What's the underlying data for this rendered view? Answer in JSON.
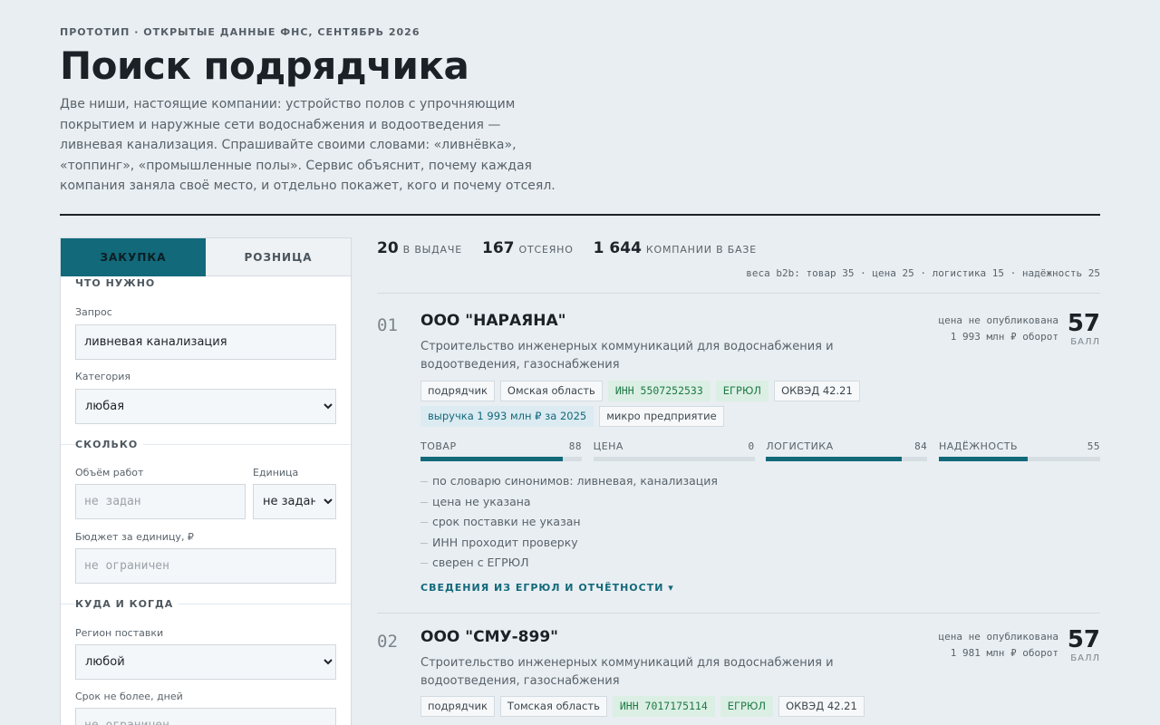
{
  "header": {
    "eyebrow": "ПРОТОТИП · ОТКРЫТЫЕ ДАННЫЕ ФНС, СЕНТЯБРЬ 2026",
    "title": "Поиск подрядчика",
    "lead": "Две ниши, настоящие компании: устройство полов с упрочняющим покрытием и наружные сети водоснабжения и водоотведения — ливневая канализация. Спрашивайте своими словами: «ливнёвка», «топпинг», «промышленные полы». Сервис объяснит, почему каждая компания заняла своё место, и отдельно покажет, кого и почему отсеял."
  },
  "tabs": [
    {
      "label": "ЗАКУПКА",
      "active": true
    },
    {
      "label": "РОЗНИЦА",
      "active": false
    }
  ],
  "form": {
    "what": {
      "title": "ЧТО НУЖНО",
      "query_label": "Запрос",
      "query_value": "ливневая канализация",
      "category_label": "Категория",
      "category_value": "любая"
    },
    "how_much": {
      "title": "СКОЛЬКО",
      "volume_label": "Объём работ",
      "volume_placeholder": "не задан",
      "unit_label": "Единица",
      "unit_value": "не задан",
      "budget_label": "Бюджет за единицу, ₽",
      "budget_placeholder": "не ограничен"
    },
    "where_when": {
      "title": "КУДА И КОГДА",
      "region_label": "Регион поставки",
      "region_value": "любой",
      "deadline_label": "Срок не более, дней",
      "deadline_placeholder": "не ограничен"
    }
  },
  "stats": [
    {
      "value": "20",
      "label": "В ВЫДАЧЕ"
    },
    {
      "value": "167",
      "label": "ОТСЕЯНО"
    },
    {
      "value": "1 644",
      "label": "КОМПАНИИ В БАЗЕ"
    }
  ],
  "weights": "веса b2b: товар 35 · цена 25 · логистика 15 · надёжность 25",
  "results": [
    {
      "rank": "01",
      "name": "ООО \"НАРАЯНА\"",
      "description": "Строительство инженерных коммуникаций для водоснабжения и водоотведения, газоснабжения",
      "price": "цена не опубликована",
      "turnover": "1 993 млн ₽ оборот",
      "score": "57",
      "score_label": "БАЛЛ",
      "tags_row1": [
        {
          "text": "подрядчик",
          "style": "plain"
        },
        {
          "text": "Омская область",
          "style": "plain"
        },
        {
          "text": "ИНН 5507252533",
          "style": "green"
        },
        {
          "text": "ЕГРЮЛ",
          "style": "green"
        },
        {
          "text": "ОКВЭД 42.21",
          "style": "plain"
        }
      ],
      "tags_row2": [
        {
          "text": "выручка 1 993 млн ₽ за 2025",
          "style": "blue"
        },
        {
          "text": "микро предприятие",
          "style": "plain"
        }
      ],
      "bars": [
        {
          "label": "ТОВАР",
          "value": 88
        },
        {
          "label": "ЦЕНА",
          "value": 0
        },
        {
          "label": "ЛОГИСТИКА",
          "value": 84
        },
        {
          "label": "НАДЁЖНОСТЬ",
          "value": 55
        }
      ],
      "reasons": [
        "по словарю синонимов: ливневая, канализация",
        "цена не указана",
        "срок поставки не указан",
        "ИНН проходит проверку",
        "сверен с ЕГРЮЛ"
      ],
      "more": "СВЕДЕНИЯ ИЗ ЕГРЮЛ И ОТЧЁТНОСТИ ▾"
    },
    {
      "rank": "02",
      "name": "ООО \"СМУ-899\"",
      "description": "Строительство инженерных коммуникаций для водоснабжения и водоотведения, газоснабжения",
      "price": "цена не опубликована",
      "turnover": "1 981 млн ₽ оборот",
      "score": "57",
      "score_label": "БАЛЛ",
      "tags_row1": [
        {
          "text": "подрядчик",
          "style": "plain"
        },
        {
          "text": "Томская область",
          "style": "plain"
        },
        {
          "text": "ИНН 7017175114",
          "style": "green"
        },
        {
          "text": "ЕГРЮЛ",
          "style": "green"
        },
        {
          "text": "ОКВЭД 42.21",
          "style": "plain"
        }
      ]
    }
  ],
  "colors": {
    "accent": "#11697a",
    "background": "#e9eef2",
    "green_tag": "#dcefe4",
    "blue_tag": "#dceaf1"
  }
}
